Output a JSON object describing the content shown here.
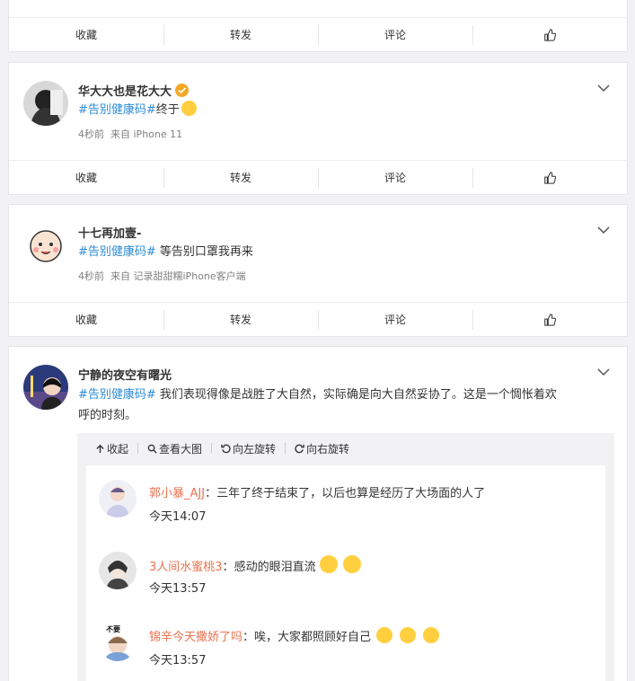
{
  "actions": {
    "collect": "收藏",
    "forward": "转发",
    "comment": "评论"
  },
  "posts": [
    {
      "author": "华大大也是花大大",
      "hashtag": "#告别健康码#",
      "text": "终于",
      "time": "4秒前",
      "source_prefix": "来自",
      "source": "iPhone 11"
    },
    {
      "author": "十七再加壹-",
      "hashtag": "#告别健康码#",
      "text": " 等告别口罩我再来",
      "time": "4秒前",
      "source_prefix": "来自",
      "source": "记录甜甜糯iPhone客户端"
    },
    {
      "author": "宁静的夜空有曙光",
      "hashtag": "#告别健康码#",
      "text_line1": " 我们表现得像是战胜了大自然，实际确是向大自然妥协了。这是一个惆怅着欢",
      "text_line2": "呼的时刻。",
      "media_tools": [
        "收起",
        "查看大图",
        "向左旋转",
        "向右旋转"
      ],
      "comments": [
        {
          "user": "郭小暴_AJJ",
          "text": "三年了终于结束了，以后也算是经历了大场面的人了",
          "time": "今天14:07"
        },
        {
          "user": "3人间水蜜桃3",
          "text": "感动的眼泪直流",
          "time": "今天13:57"
        },
        {
          "user": "锦辛今天撒娇了吗",
          "text": "唉，大家都照顾好自己",
          "time": "今天13:57",
          "avatar_label": "不要"
        }
      ]
    }
  ],
  "colors": {
    "username": "#eb7350",
    "hashtag": "#2d8cd6",
    "verified": "#f5a623"
  }
}
